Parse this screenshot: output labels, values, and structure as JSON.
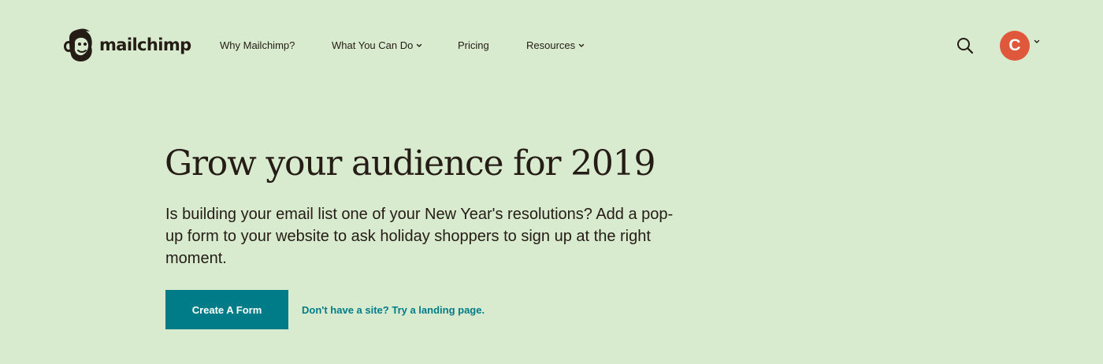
{
  "brand": {
    "logo_text": "mailchimp",
    "logo_icon": "freddie-chimp-icon"
  },
  "nav": {
    "items": [
      {
        "label": "Why Mailchimp?",
        "has_dropdown": false
      },
      {
        "label": "What You Can Do",
        "has_dropdown": true
      },
      {
        "label": "Pricing",
        "has_dropdown": false
      },
      {
        "label": "Resources",
        "has_dropdown": true
      }
    ]
  },
  "header": {
    "search_icon": "search-icon",
    "avatar_initial": "C",
    "avatar_color": "#e0583c"
  },
  "hero": {
    "title": "Grow your audience for 2019",
    "body": "Is building your email list one of your New Year's resolutions? Add a pop-up form to your website to ask holiday shoppers to sign up at the right moment.",
    "cta_label": "Create A Form",
    "secondary_link": "Don't have a site? Try a landing page."
  },
  "colors": {
    "background": "#d8ebcf",
    "text": "#241c15",
    "accent": "#007c89",
    "avatar": "#e0583c"
  }
}
